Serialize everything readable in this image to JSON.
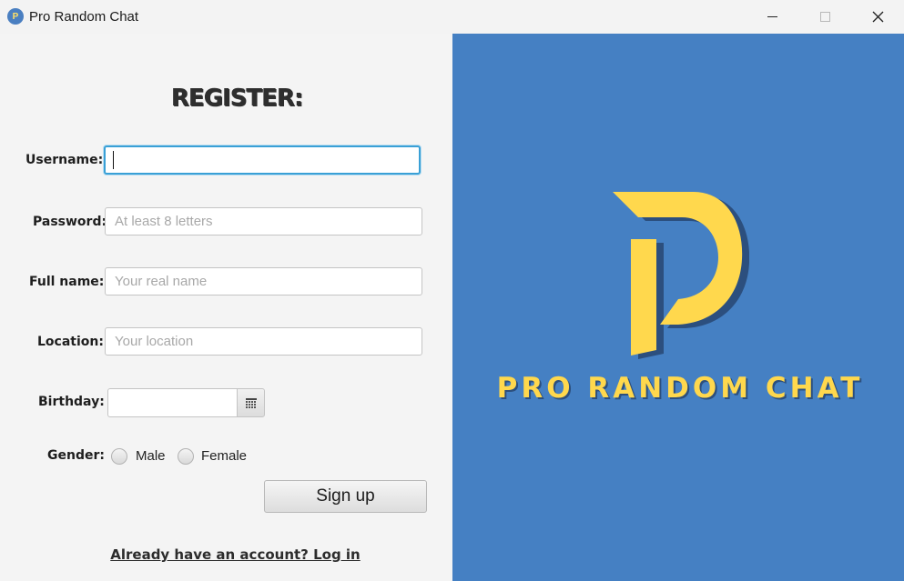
{
  "window": {
    "title": "Pro Random Chat",
    "icon_letter": "P",
    "controls": [
      "minimize-icon",
      "maximize-icon",
      "close-icon"
    ]
  },
  "form": {
    "heading": "REGISTER:",
    "username": {
      "label": "Username:",
      "value": "",
      "placeholder": ""
    },
    "password": {
      "label": "Password:",
      "value": "",
      "placeholder": "At least 8 letters"
    },
    "fullname": {
      "label": "Full name:",
      "value": "",
      "placeholder": "Your real name"
    },
    "location": {
      "label": "Location:",
      "value": "",
      "placeholder": "Your location"
    },
    "birthday": {
      "label": "Birthday:",
      "value": "",
      "picker_icon": "calendar-icon"
    },
    "gender": {
      "label": "Gender:",
      "options": [
        "Male",
        "Female"
      ],
      "selected": null
    },
    "submit_label": "Sign up",
    "login_link": "Already have an account? Log in"
  },
  "brand": {
    "name": "PRO RANDOM CHAT",
    "background_color": "#4580c3",
    "logo_color": "#ffd84d",
    "logo_shadow_color": "#2c4f7e"
  }
}
